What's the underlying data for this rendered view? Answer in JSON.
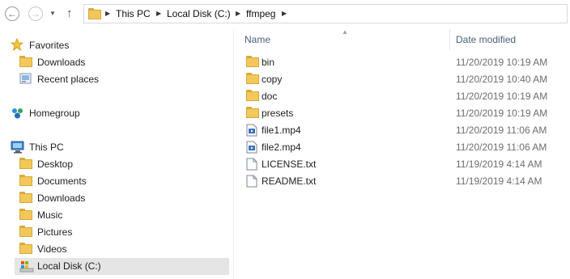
{
  "address_bar": {
    "crumbs": [
      "This PC",
      "Local Disk (C:)",
      "ffmpeg"
    ]
  },
  "nav": {
    "favorites": {
      "label": "Favorites",
      "items": [
        "Downloads",
        "Recent places"
      ]
    },
    "homegroup": {
      "label": "Homegroup"
    },
    "this_pc": {
      "label": "This PC",
      "items": [
        "Desktop",
        "Documents",
        "Downloads",
        "Music",
        "Pictures",
        "Videos",
        "Local Disk (C:)"
      ]
    }
  },
  "columns": {
    "name": "Name",
    "date": "Date modified"
  },
  "files": [
    {
      "name": "bin",
      "date": "11/20/2019 10:19 AM",
      "type": "folder"
    },
    {
      "name": "copy",
      "date": "11/20/2019 10:40 AM",
      "type": "folder"
    },
    {
      "name": "doc",
      "date": "11/20/2019 10:19 AM",
      "type": "folder"
    },
    {
      "name": "presets",
      "date": "11/20/2019 10:19 AM",
      "type": "folder"
    },
    {
      "name": "file1.mp4",
      "date": "11/20/2019 11:06 AM",
      "type": "video"
    },
    {
      "name": "file2.mp4",
      "date": "11/20/2019 11:06 AM",
      "type": "video"
    },
    {
      "name": "LICENSE.txt",
      "date": "11/19/2019 4:14 AM",
      "type": "text"
    },
    {
      "name": "README.txt",
      "date": "11/19/2019 4:14 AM",
      "type": "text"
    }
  ],
  "colors": {
    "header_text": "#4c607a",
    "date_text": "#6d6d6d",
    "selected_bg": "#e5e5e5",
    "folder": "#f3c85a"
  }
}
